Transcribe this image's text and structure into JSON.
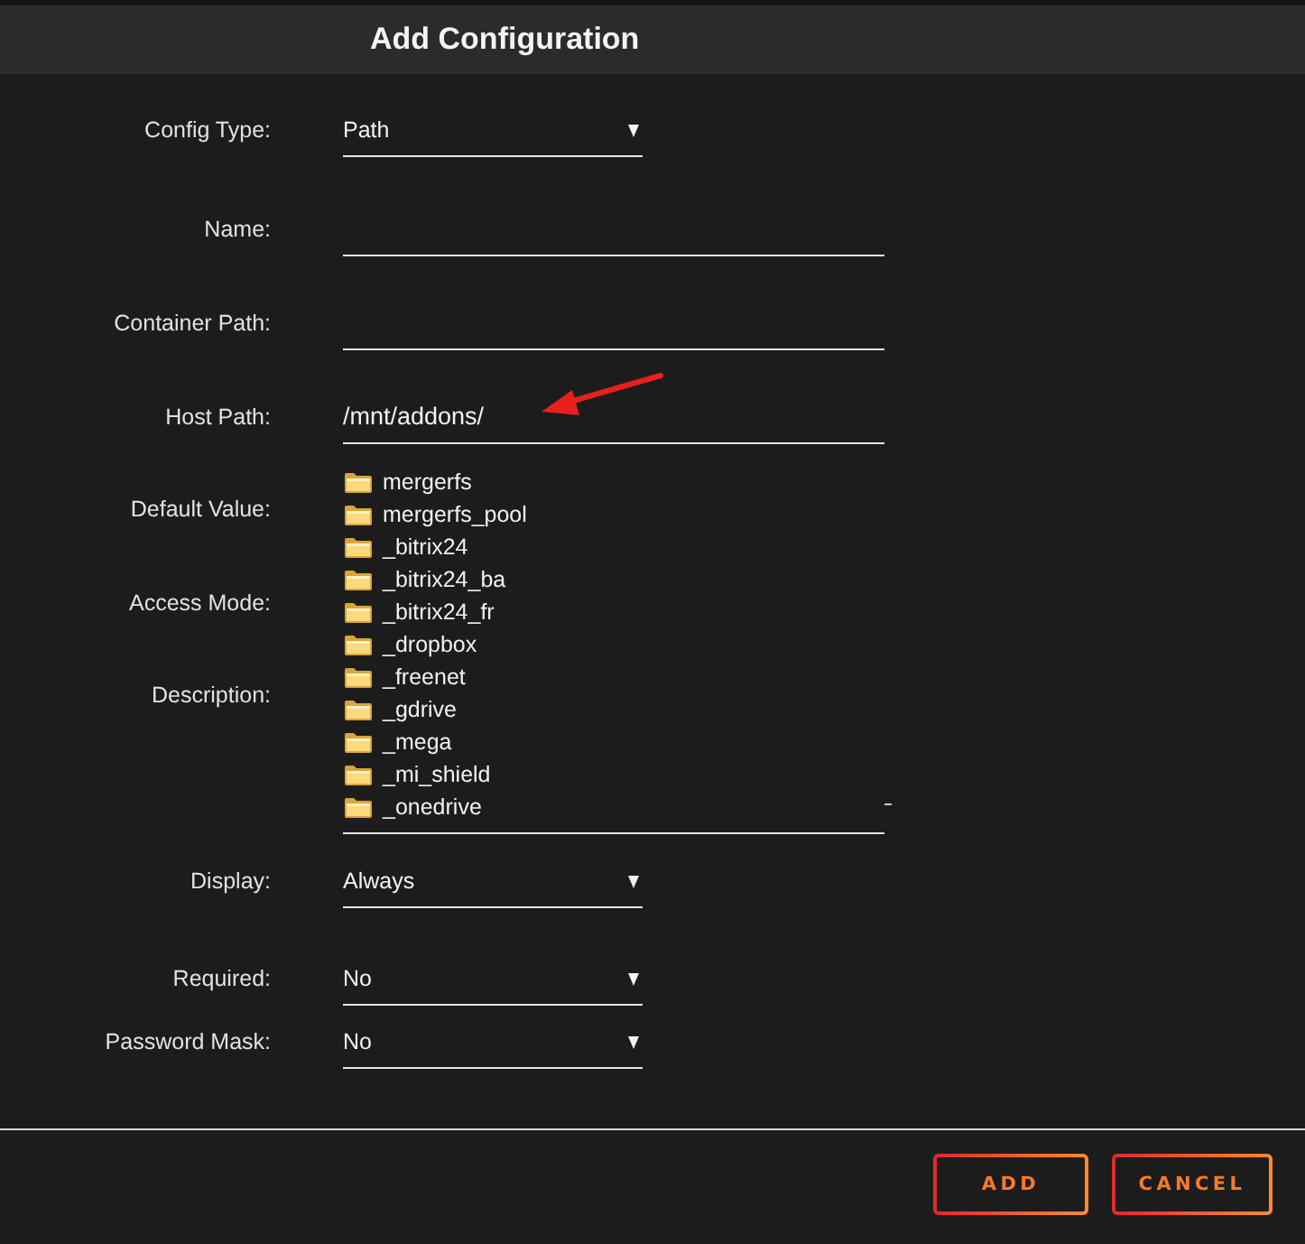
{
  "dialog": {
    "title": "Add Configuration"
  },
  "fields": [
    {
      "kind": "select",
      "label": "Config Type:",
      "value": "Path"
    },
    {
      "kind": "text",
      "label": "Name:"
    },
    {
      "kind": "text",
      "label": "Container Path:"
    },
    {
      "kind": "text",
      "label": "Host Path:",
      "value": "/mnt/addons/"
    },
    {
      "kind": "browse",
      "labels": [
        "Default Value:",
        "Access Mode:",
        "Description:"
      ],
      "folders": [
        {
          "name": "mergerfs"
        },
        {
          "name": "mergerfs_pool"
        },
        {
          "name": "_bitrix24"
        },
        {
          "name": "_bitrix24_ba"
        },
        {
          "name": "_bitrix24_fr"
        },
        {
          "name": "_dropbox"
        },
        {
          "name": "_freenet"
        },
        {
          "name": "_gdrive"
        },
        {
          "name": "_mega"
        },
        {
          "name": "_mi_shield"
        },
        {
          "name": "_onedrive"
        }
      ]
    },
    {
      "kind": "select",
      "label": "Display:",
      "value": "Always"
    },
    {
      "kind": "select",
      "label": "Required:",
      "value": "No"
    },
    {
      "kind": "select",
      "label": "Password Mask:",
      "value": "No"
    }
  ],
  "buttons": [
    {
      "label": "ADD"
    },
    {
      "label": "CANCEL"
    }
  ]
}
